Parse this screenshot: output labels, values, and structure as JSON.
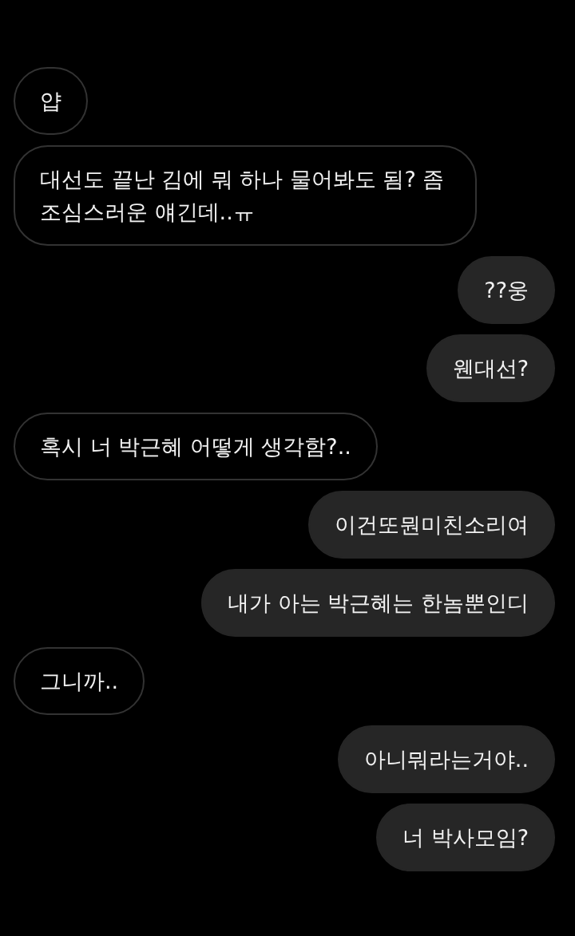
{
  "messages": [
    {
      "kind": "received",
      "text": "얍"
    },
    {
      "kind": "received",
      "text": "대선도 끝난 김에 뭐 하나 물어봐도 됨? 좀 조심스러운 얘긴데..ㅠ"
    },
    {
      "kind": "sent",
      "text": "??웅"
    },
    {
      "kind": "sent",
      "text": "웬대선?"
    },
    {
      "kind": "received",
      "text": "혹시 너 박근혜 어떻게 생각함?.."
    },
    {
      "kind": "sent",
      "text": "이건또뭔미친소리여"
    },
    {
      "kind": "sent",
      "text": "내가 아는 박근혜는 한놈뿐인디"
    },
    {
      "kind": "received",
      "text": "그니까.."
    },
    {
      "kind": "sent",
      "text": "아니뭐라는거야.."
    },
    {
      "kind": "sent",
      "text": "너 박사모임?"
    }
  ]
}
